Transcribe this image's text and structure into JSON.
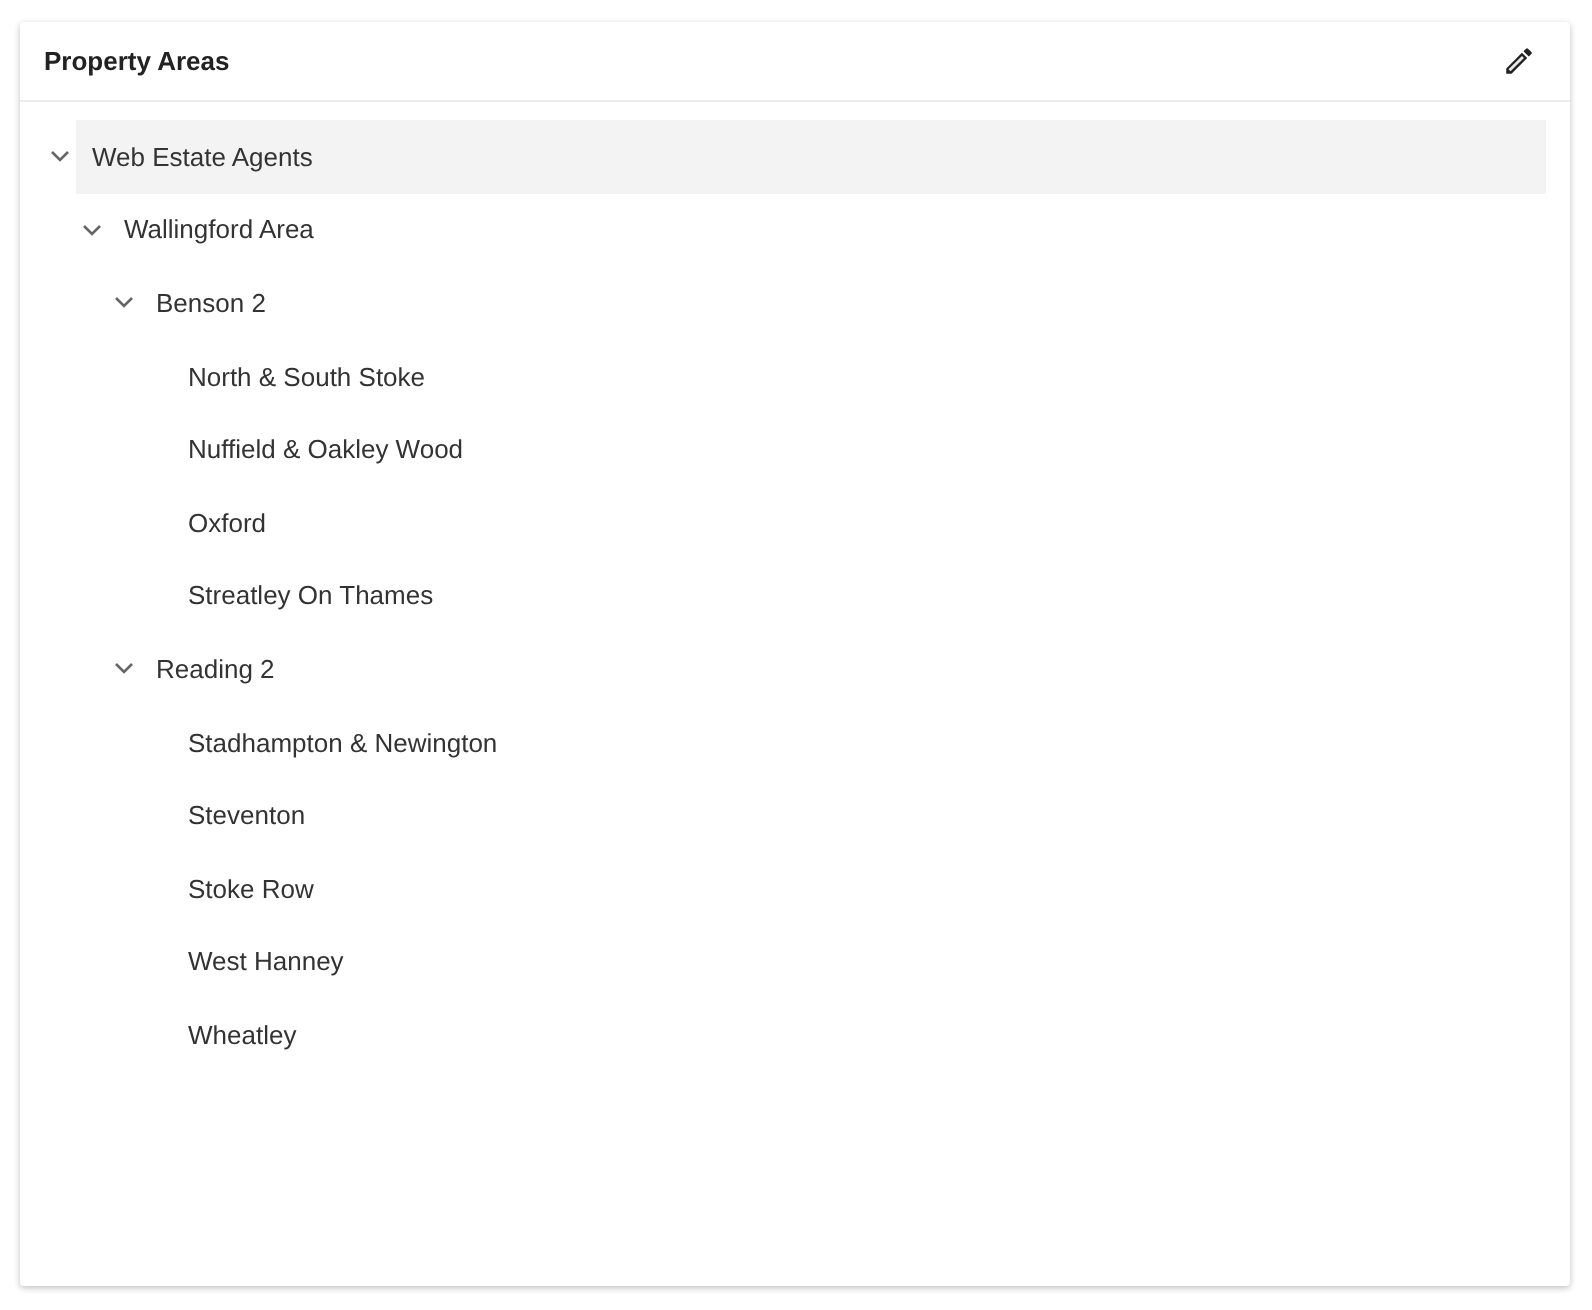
{
  "panel": {
    "title": "Property Areas",
    "tree": [
      {
        "label": "Web Estate Agents",
        "selected": true,
        "expanded": true,
        "children": [
          {
            "label": "Wallingford Area",
            "selected": false,
            "expanded": true,
            "children": [
              {
                "label": "Benson 2",
                "selected": false,
                "expanded": true,
                "children": [
                  {
                    "label": "North & South Stoke",
                    "selected": false
                  },
                  {
                    "label": "Nuffield & Oakley Wood",
                    "selected": false
                  },
                  {
                    "label": "Oxford",
                    "selected": false
                  },
                  {
                    "label": "Streatley On Thames",
                    "selected": false
                  }
                ]
              },
              {
                "label": "Reading 2",
                "selected": false,
                "expanded": true,
                "children": [
                  {
                    "label": "Stadhampton & Newington",
                    "selected": false
                  },
                  {
                    "label": "Steventon",
                    "selected": false
                  },
                  {
                    "label": "Stoke Row",
                    "selected": false
                  },
                  {
                    "label": "West Hanney",
                    "selected": false
                  },
                  {
                    "label": "Wheatley",
                    "selected": false
                  }
                ]
              }
            ]
          }
        ]
      }
    ]
  }
}
